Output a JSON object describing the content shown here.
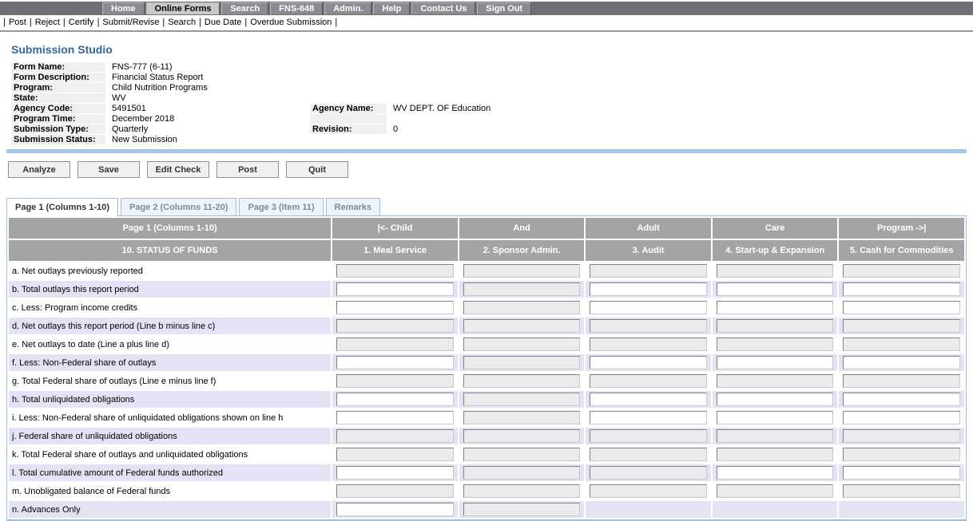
{
  "nav": {
    "tabs": [
      {
        "label": "Home",
        "active": false
      },
      {
        "label": "Online Forms",
        "active": true
      },
      {
        "label": "Search",
        "active": false
      },
      {
        "label": "FNS-648",
        "active": false
      },
      {
        "label": "Admin.",
        "active": false
      },
      {
        "label": "Help",
        "active": false
      },
      {
        "label": "Contact Us",
        "active": false
      },
      {
        "label": "Sign Out",
        "active": false
      }
    ],
    "menu_items": [
      "Post",
      "Reject",
      "Certify",
      "Submit/Revise",
      "Search",
      "Due Date",
      "Overdue Submission"
    ]
  },
  "page_title": "Submission Studio",
  "form_info": {
    "rows": [
      {
        "label": "Form Name:",
        "value": "FNS-777 (6-11)",
        "right_label": null,
        "right_value": null
      },
      {
        "label": "Form Description:",
        "value": "Financial Status Report",
        "right_label": null,
        "right_value": null
      },
      {
        "label": "Program:",
        "value": "Child Nutrition Programs",
        "right_label": null,
        "right_value": null
      },
      {
        "label": "State:",
        "value": "WV",
        "right_label": null,
        "right_value": null
      },
      {
        "label": "Agency Code:",
        "value": "5491501",
        "right_label": "Agency Name:",
        "right_value": "WV DEPT. OF Education"
      },
      {
        "label": "Program Time:",
        "value": "December 2018",
        "right_label": "",
        "right_value": ""
      },
      {
        "label": "Submission Type:",
        "value": "Quarterly",
        "right_label": "Revision:",
        "right_value": "0"
      },
      {
        "label": "Submission Status:",
        "value": "New Submission",
        "right_label": null,
        "right_value": null
      }
    ]
  },
  "toolbar": {
    "buttons": [
      "Analyze",
      "Save",
      "Edit Check",
      "Post",
      "Quit"
    ]
  },
  "page_tabs": [
    {
      "label": "Page 1 (Columns 1-10)",
      "active": true
    },
    {
      "label": "Page 2 (Columns 11-20)",
      "active": false
    },
    {
      "label": "Page 3 (Item 11)",
      "active": false
    },
    {
      "label": "Remarks",
      "active": false
    }
  ],
  "table": {
    "header_row1": [
      "Page 1 (Columns 1-10)",
      "|<- Child",
      "And",
      "Adult",
      "Care",
      "Program ->|"
    ],
    "header_row2": [
      "10. STATUS OF FUNDS",
      "1. Meal Service",
      "2. Sponsor Admin.",
      "3. Audit",
      "4. Start-up & Expansion",
      "5. Cash for Commodities"
    ],
    "rows": [
      {
        "label": "a. Net outlays previously reported",
        "inputs": [
          "disabled",
          "disabled",
          "disabled",
          "disabled",
          "disabled"
        ]
      },
      {
        "label": "b. Total outlays this report period",
        "inputs": [
          "editable",
          "disabled",
          "editable",
          "editable",
          "editable"
        ]
      },
      {
        "label": "c. Less: Program income credits",
        "inputs": [
          "editable",
          "disabled",
          "editable",
          "editable",
          "editable"
        ]
      },
      {
        "label": "d. Net outlays this report period (Line b minus line c)",
        "inputs": [
          "disabled",
          "disabled",
          "disabled",
          "disabled",
          "disabled"
        ]
      },
      {
        "label": "e. Net outlays to date (Line a plus line d)",
        "inputs": [
          "disabled",
          "disabled",
          "disabled",
          "disabled",
          "disabled"
        ]
      },
      {
        "label": "f. Less: Non-Federal share of outlays",
        "inputs": [
          "editable",
          "disabled",
          "editable",
          "editable",
          "editable"
        ]
      },
      {
        "label": "g. Total Federal share of outlays (Line e minus line f)",
        "inputs": [
          "disabled",
          "disabled",
          "disabled",
          "disabled",
          "disabled"
        ]
      },
      {
        "label": "h. Total unliquidated obligations",
        "inputs": [
          "editable",
          "disabled",
          "editable",
          "editable",
          "editable"
        ]
      },
      {
        "label": "i. Less: Non-Federal share of unliquidated obligations shown on line h",
        "inputs": [
          "editable",
          "disabled",
          "editable",
          "editable",
          "editable"
        ]
      },
      {
        "label": "j. Federal share of unliquidated obligations",
        "inputs": [
          "disabled",
          "disabled",
          "disabled",
          "disabled",
          "disabled"
        ]
      },
      {
        "label": "k. Total Federal share of outlays and unliquidated obligations",
        "inputs": [
          "disabled",
          "disabled",
          "disabled",
          "disabled",
          "disabled"
        ]
      },
      {
        "label": "l. Total cumulative amount of Federal funds authorized",
        "inputs": [
          "editable",
          "disabled",
          "disabled",
          "editable",
          "editable"
        ]
      },
      {
        "label": "m. Unobligated balance of Federal funds",
        "inputs": [
          "disabled",
          "disabled",
          "disabled",
          "disabled",
          "disabled"
        ]
      },
      {
        "label": "n. Advances Only",
        "inputs": [
          "editable",
          "disabled",
          "none",
          "none",
          "none"
        ]
      }
    ],
    "input_values": ""
  },
  "colors": {
    "title_blue": "#336699",
    "nav_bg": "#6f6f78",
    "nav_btn": "#8b8b93",
    "nav_btn_active": "#c8c8c8",
    "menu_rule": "#939aa6",
    "info_label_bg": "#efefef",
    "divider_blue": "#a3c7e8",
    "btn_bg": "#f0f0f0",
    "btn_border": "#919191",
    "tab_border": "#9fbcda",
    "tab_inactive_bg": "#eef3f9",
    "tab_inactive_text": "#7d8a9c",
    "header_gray": "#a4a4a4",
    "row_alt": "#e3e3f5",
    "input_border_dark": "#808080",
    "input_border_light": "#c8c8c8",
    "input_disabled_bg": "#ebebeb"
  }
}
